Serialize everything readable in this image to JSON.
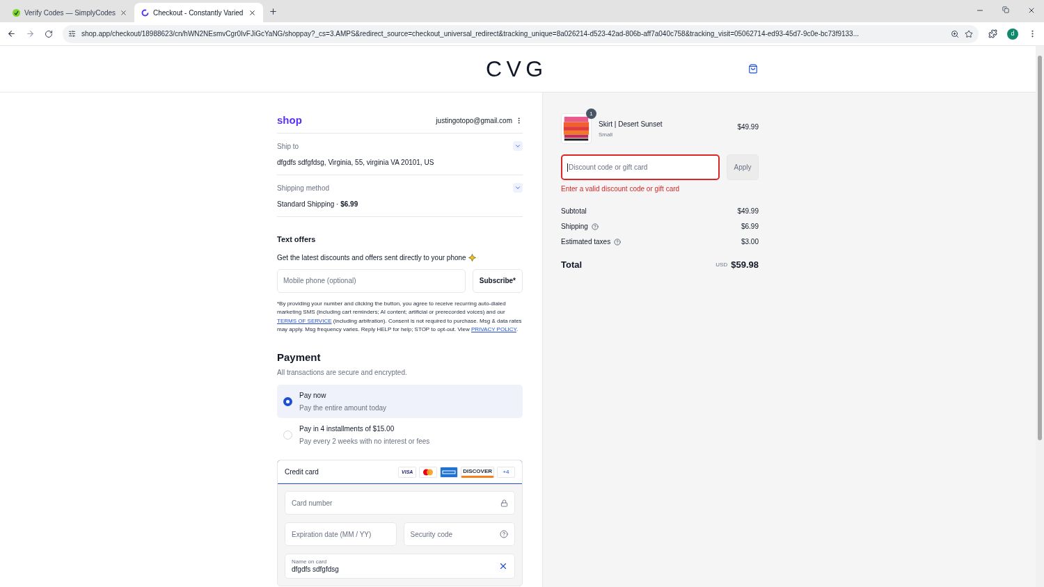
{
  "browser": {
    "tabs": [
      {
        "title": "Verify Codes — SimplyCodes",
        "selected": false
      },
      {
        "title": "Checkout - Constantly Varied",
        "selected": true
      }
    ],
    "url": "shop.app/checkout/18988623/cn/hWN2NEsmvCgr0IvFJiGcYaNG/shoppay?_cs=3.AMPS&redirect_source=checkout_universal_redirect&tracking_unique=8a026214-d523-42ad-806b-aff7a040c758&tracking_visit=05062714-ed93-45d7-9c0e-bc73f9133...",
    "profile": "d"
  },
  "header": {
    "logo": "CVG"
  },
  "checkout": {
    "brand": "shop",
    "email": "justingotopo@gmail.com",
    "sections": [
      {
        "label": "Ship to",
        "value": "dfgdfs sdfgfdsg, Virginia, 55, virginia VA 20101, US"
      },
      {
        "label": "Shipping method",
        "value": "Standard Shipping · **$6.99**"
      }
    ],
    "text_offers": {
      "title": "Text offers",
      "description": "Get the latest discounts and offers sent directly to your phone",
      "phone_placeholder": "Mobile phone (optional)",
      "button": "Subscribe*",
      "legal": {
        "before": "*By providing your number and clicking the button, you agree to receive recurring auto-dialed marketing SMS (including cart reminders; AI content; artificial or prerecorded voices) and our",
        "terms_link": "TERMS OF SERVICE",
        "middle": "(including arbitration). Consent is not required to purchase. Msg & data rates may apply. Msg frequency varies. Reply HELP for help; STOP to opt-out. View",
        "privacy_link": "PRIVACY POLICY",
        "after": "."
      }
    },
    "payment": {
      "title": "Payment",
      "subtitle": "All transactions are secure and encrypted.",
      "options": [
        {
          "label": "Pay now",
          "detail": "Pay the entire amount today",
          "selected": true
        },
        {
          "label": "Pay in 4 installments of $15.00",
          "detail": "Pay every 2 weeks with no interest or fees",
          "selected": false
        }
      ],
      "method": {
        "label": "Credit card",
        "brands": [
          {
            "kind": "visa",
            "label": "VISA"
          },
          {
            "kind": "mastercard"
          },
          {
            "kind": "amex"
          },
          {
            "kind": "discover",
            "label": "DISCOVER"
          },
          {
            "kind": "more",
            "label": "+4"
          }
        ]
      },
      "fields": [
        {
          "kind": "card_number",
          "placeholder": "Card number"
        },
        {
          "kind": "expiry",
          "placeholder": "Expiration date (MM / YY)"
        },
        {
          "kind": "security_code",
          "placeholder": "Security code"
        },
        {
          "kind": "name",
          "label": "Name on card",
          "value": "dfgdfs sdfgfdsg"
        }
      ]
    }
  },
  "summary": {
    "items": [
      {
        "name": "Skirt | Desert Sunset",
        "variant": "Small",
        "price": "$49.99",
        "quantity": "1"
      }
    ],
    "discount": {
      "placeholder": "Discount code or gift card",
      "button": "Apply",
      "error": "Enter a valid discount code or gift card"
    },
    "lines": [
      {
        "label": "Subtotal",
        "value": "$49.99",
        "help": false
      },
      {
        "label": "Shipping",
        "value": "$6.99",
        "help": true
      },
      {
        "label": "Estimated taxes",
        "value": "$3.00",
        "help": true
      }
    ],
    "total": {
      "label": "Total",
      "currency": "USD",
      "value": "$59.98"
    }
  }
}
